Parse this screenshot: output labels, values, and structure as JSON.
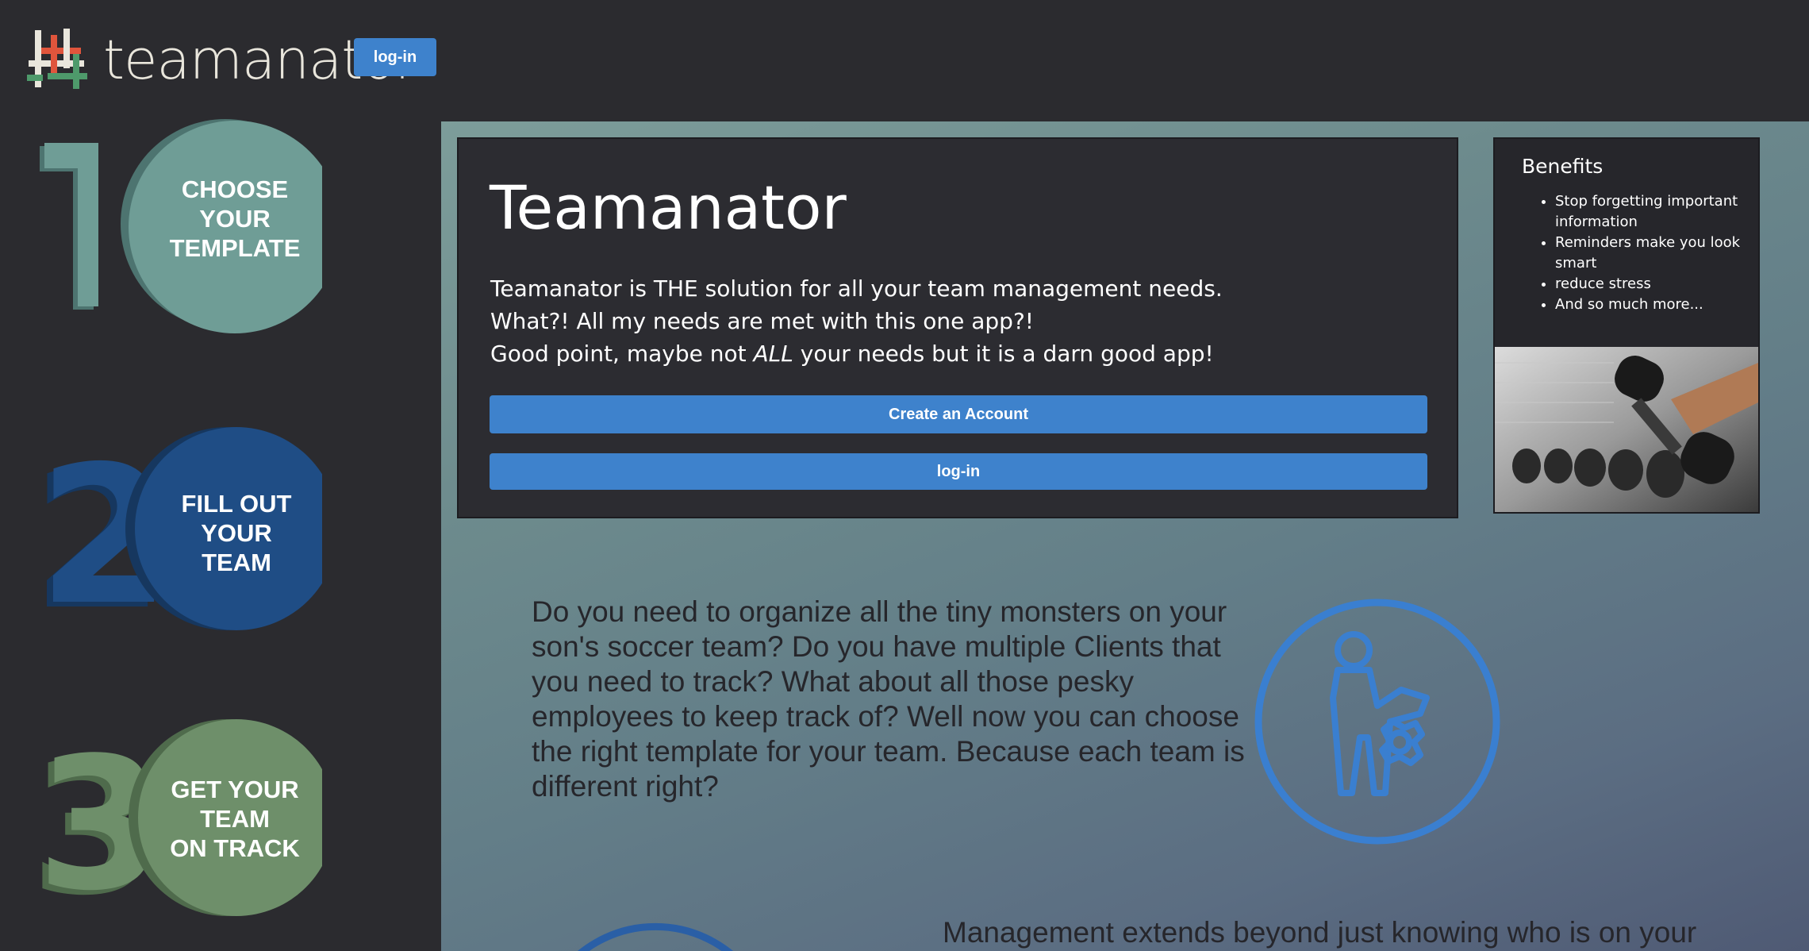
{
  "header": {
    "brand_name": "teamanator",
    "login_label": "log-in"
  },
  "steps": [
    {
      "number": "1",
      "label_lines": [
        "CHOOSE",
        "YOUR",
        "TEMPLATE"
      ],
      "color": "#6f9d96",
      "dark": "#4d7470"
    },
    {
      "number": "2",
      "label_lines": [
        "FILL OUT",
        "YOUR",
        "TEAM"
      ],
      "color": "#1f4d85",
      "dark": "#16375f"
    },
    {
      "number": "3",
      "label_lines": [
        "GET YOUR",
        "TEAM",
        "ON TRACK"
      ],
      "color": "#6e8f6a",
      "dark": "#4f6b4c"
    }
  ],
  "hero": {
    "title": "Teamanator",
    "line1": "Teamanator is THE solution for all your team management needs.",
    "line2": "What?! All my needs are met with this one app?!",
    "line3_pre": "Good point, maybe not ",
    "line3_em": "ALL",
    "line3_post": " your needs but it is a darn good app!",
    "create_label": "Create an Account",
    "login_label": "log-in"
  },
  "benefits": {
    "title": "Benefits",
    "items": [
      "Stop forgetting important information",
      "Reminders make you look smart",
      "reduce stress",
      "And so much more..."
    ]
  },
  "content": {
    "paragraph1": "Do you need to organize all the tiny monsters on your son's soccer team? Do you have multiple Clients that you need to track? What about all those pesky employees to keep track of? Well now you can choose the right template for your team. Because each team is different right?",
    "paragraph2": "Management extends beyond just knowing who is on your"
  },
  "colors": {
    "accent": "#3e82cc",
    "background": "#2b2b2f",
    "card": "#2c2c31"
  },
  "icons": {
    "logo": "teamanator-logo-icon",
    "team": "team-member-gear-icon",
    "photo": "dumbbell-photo"
  }
}
